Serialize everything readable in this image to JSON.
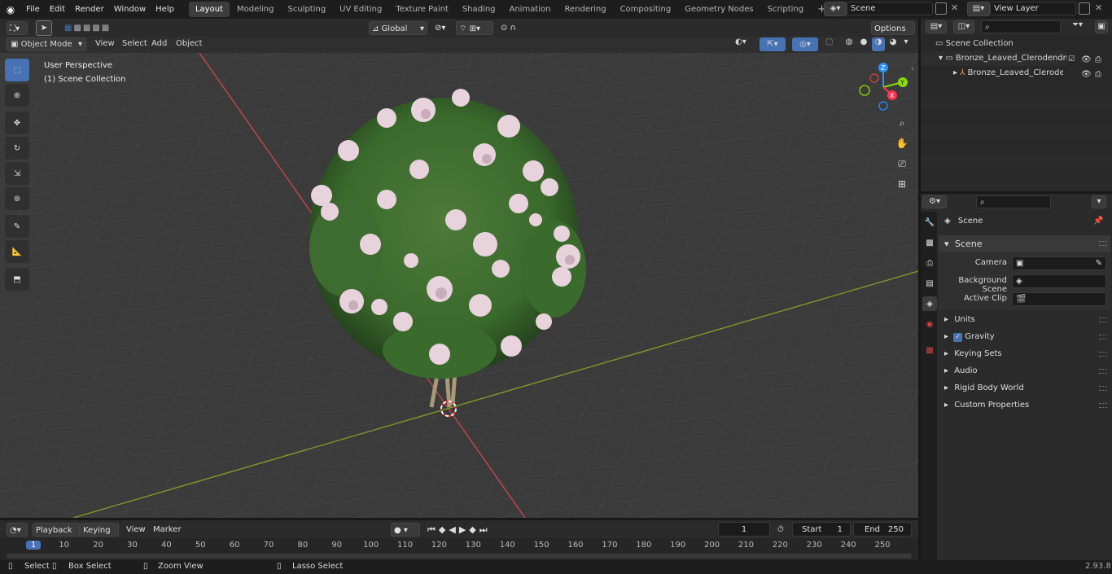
{
  "menu": {
    "file": "File",
    "edit": "Edit",
    "render": "Render",
    "window": "Window",
    "help": "Help"
  },
  "workspaces": [
    "Layout",
    "Modeling",
    "Sculpting",
    "UV Editing",
    "Texture Paint",
    "Shading",
    "Animation",
    "Rendering",
    "Compositing",
    "Geometry Nodes",
    "Scripting"
  ],
  "scene_field": "Scene",
  "view_layer_field": "View Layer",
  "viewport_header": {
    "mode": "Object Mode",
    "view": "View",
    "select": "Select",
    "add": "Add",
    "object": "Object",
    "orientation": "Global",
    "options": "Options"
  },
  "viewport": {
    "perspective": "User Perspective",
    "collection": "(1) Scene Collection"
  },
  "gizmo": {
    "z": "Z",
    "y": "Y",
    "x": "X"
  },
  "outliner": {
    "root": "Scene Collection",
    "items": [
      "Bronze_Leaved_Clerodendrum",
      "Bronze_Leaved_Clerodendrum"
    ]
  },
  "properties": {
    "context": "Scene",
    "panel": "Scene",
    "fields": [
      {
        "label": "Camera"
      },
      {
        "label": "Background Scene"
      },
      {
        "label": "Active Clip"
      }
    ],
    "sections": [
      "Units",
      "Gravity",
      "Keying Sets",
      "Audio",
      "Rigid Body World",
      "Custom Properties"
    ],
    "gravity_checked": true
  },
  "timeline_header": {
    "playback": "Playback",
    "keying": "Keying",
    "view": "View",
    "marker": "Marker",
    "current_frame": "1",
    "start_label": "Start",
    "start": "1",
    "end_label": "End",
    "end": "250"
  },
  "timeline": {
    "ticks": [
      "1",
      "10",
      "20",
      "30",
      "40",
      "50",
      "60",
      "70",
      "80",
      "90",
      "100",
      "110",
      "120",
      "130",
      "140",
      "150",
      "160",
      "170",
      "180",
      "190",
      "200",
      "210",
      "220",
      "230",
      "240",
      "250"
    ]
  },
  "status": {
    "select": "Select",
    "box_select": "Box Select",
    "zoom_view": "Zoom View",
    "lasso_select": "Lasso Select",
    "version": "2.93.8"
  },
  "colors": {
    "accent": "#4772b3",
    "x_axis": "#ff3352",
    "y_axis": "#8bdc00",
    "z_axis": "#2890ff"
  }
}
